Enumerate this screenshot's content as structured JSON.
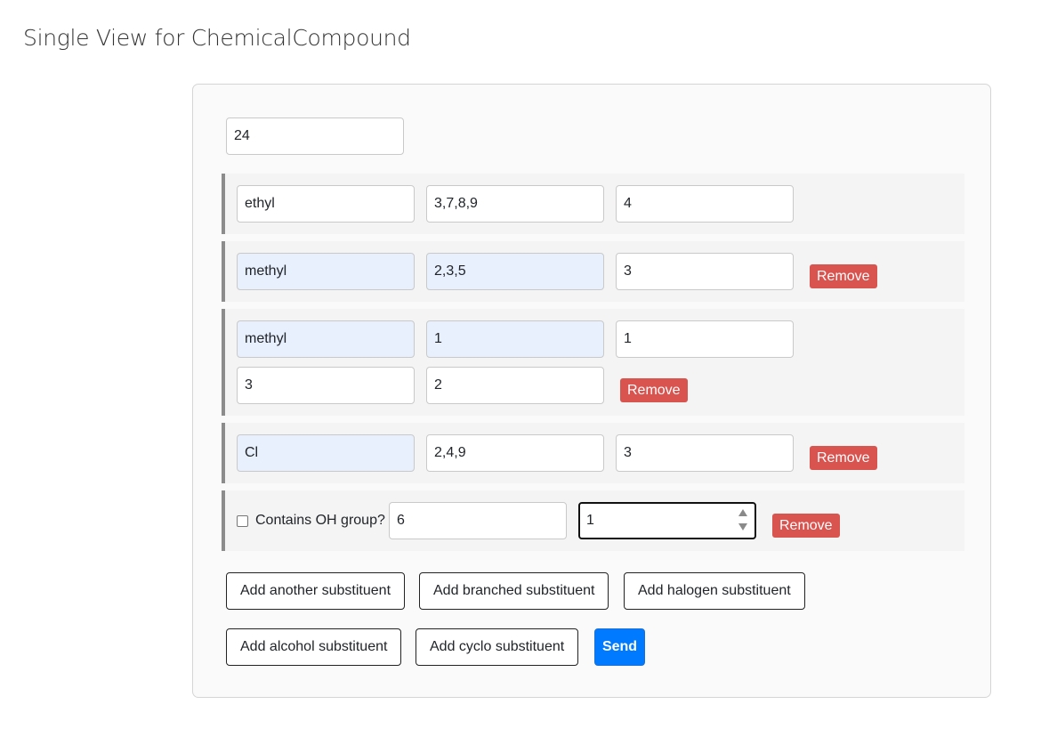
{
  "page": {
    "title": "Single View for ChemicalCompound"
  },
  "form": {
    "main_chain_length": "24",
    "substituents": [
      {
        "type": "basic",
        "name": "ethyl",
        "positions": "3,7,8,9",
        "count": "4",
        "removable": false
      },
      {
        "type": "basic",
        "name": "methyl",
        "positions": "2,3,5",
        "count": "3",
        "removable": true,
        "remove_label": "Remove"
      },
      {
        "type": "branched",
        "name": "methyl",
        "positions": "1",
        "count": "1",
        "branch_position": "3",
        "branch_length": "2",
        "removable": true,
        "remove_label": "Remove"
      },
      {
        "type": "halogen",
        "name": "Cl",
        "positions": "2,4,9",
        "count": "3",
        "removable": true,
        "remove_label": "Remove"
      },
      {
        "type": "alcohol",
        "checkbox_label": "Contains OH group?",
        "checked": false,
        "positions": "6",
        "count": "1",
        "removable": true,
        "remove_label": "Remove"
      }
    ],
    "actions": {
      "add_another": "Add another substituent",
      "add_branched": "Add branched substituent",
      "add_halogen": "Add halogen substituent",
      "add_alcohol": "Add alcohol substituent",
      "add_cyclo": "Add cyclo substituent",
      "send": "Send"
    }
  },
  "colors": {
    "remove": "#d9534f",
    "send": "#007bff",
    "autofill": "#e8f0fe",
    "group_border": "#8c8c8c"
  }
}
